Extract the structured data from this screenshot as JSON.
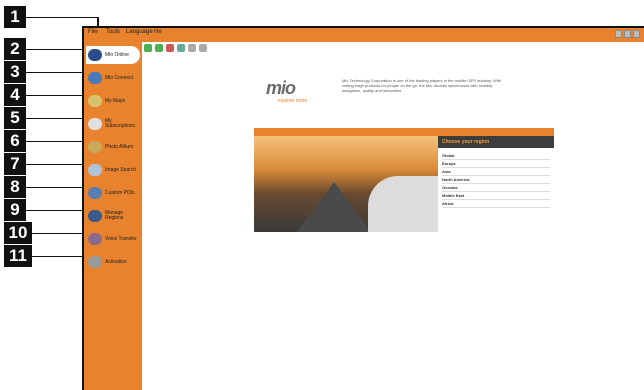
{
  "menubar": {
    "file": "File",
    "tools": "Tools",
    "language": "Language",
    "help": "He"
  },
  "sidebar": {
    "items": [
      {
        "label": "Mio Online",
        "active": true,
        "icon": "globe-icon"
      },
      {
        "label": "Mio Connect",
        "icon": "connect-icon"
      },
      {
        "label": "My Maps",
        "icon": "maps-icon"
      },
      {
        "label": "My Subscriptions",
        "icon": "subscriptions-icon"
      },
      {
        "label": "Photo Album",
        "icon": "photo-album-icon"
      },
      {
        "label": "Image Search",
        "icon": "image-search-icon"
      },
      {
        "label": "Custom POIs",
        "icon": "custom-pois-icon"
      },
      {
        "label": "Manage Regions",
        "icon": "manage-regions-icon"
      },
      {
        "label": "Voice Transfer",
        "icon": "voice-transfer-icon"
      },
      {
        "label": "Activation",
        "icon": "activation-icon"
      }
    ]
  },
  "callouts": [
    "1",
    "2",
    "3",
    "4",
    "5",
    "6",
    "7",
    "8",
    "9",
    "10",
    "11"
  ],
  "web": {
    "logo": "mio",
    "tagline": "explore more",
    "intro": "Mio Technology Corporation is one of the leading players in the mobile GPS industry. With cutting edge products for people on the go, the Mio devices synchronize with mobility, navigation, quality and innovation.",
    "region_title": "Choose your region",
    "regions": [
      "Global",
      "Europe",
      "Asia",
      "North America",
      "Oceania",
      "Middle East",
      "Africa"
    ]
  },
  "colors": {
    "accent": "#e8822c",
    "dark": "#3d3d3d"
  }
}
